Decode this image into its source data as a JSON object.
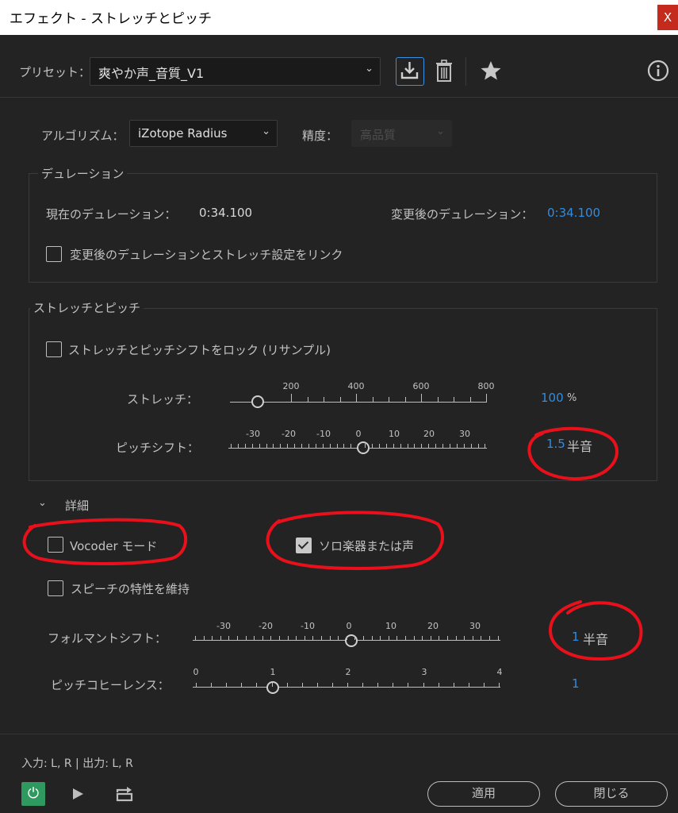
{
  "window": {
    "title": "エフェクト - ストレッチとピッチ",
    "close_glyph": "X"
  },
  "preset": {
    "label": "プリセット：",
    "value": "爽やか声_音質_V1"
  },
  "algorithm": {
    "label": "アルゴリズム：",
    "value": "iZotope Radius",
    "precision_label": "精度：",
    "precision_value": "高品質"
  },
  "duration": {
    "group_label": "デュレーション",
    "current_label": "現在のデュレーション：",
    "current_value": "0:34.100",
    "new_label": "変更後のデュレーション：",
    "new_value": "0:34.100",
    "link_label": "変更後のデュレーションとストレッチ設定をリンク",
    "link_checked": false
  },
  "stretch_pitch": {
    "group_label": "ストレッチとピッチ",
    "lock_label": "ストレッチとピッチシフトをロック (リサンプル)",
    "lock_checked": false,
    "stretch": {
      "label": "ストレッチ：",
      "ticks": [
        "200",
        "400",
        "600",
        "800"
      ],
      "value": "100",
      "unit": "%"
    },
    "pitch": {
      "label": "ピッチシフト：",
      "ticks": [
        "-30",
        "-20",
        "-10",
        "0",
        "10",
        "20",
        "30"
      ],
      "value": "1.5",
      "unit": "半音"
    }
  },
  "details": {
    "label": "詳細",
    "vocoder_label": "Vocoder モード",
    "vocoder_checked": false,
    "solo_label": "ソロ楽器または声",
    "solo_checked": true,
    "speech_label": "スピーチの特性を維持",
    "speech_checked": false,
    "formant": {
      "label": "フォルマントシフト：",
      "ticks": [
        "-30",
        "-20",
        "-10",
        "0",
        "10",
        "20",
        "30"
      ],
      "value": "1",
      "unit": "半音"
    },
    "coherence": {
      "label": "ピッチコヒーレンス：",
      "ticks": [
        "0",
        "1",
        "2",
        "3",
        "4"
      ],
      "value": "1"
    }
  },
  "footer": {
    "io_text": "入力: L, R | 出力: L, R",
    "apply_label": "適用",
    "close_label": "閉じる"
  },
  "colors": {
    "accent_blue": "#2f8de4",
    "power_green": "#2e9a5f",
    "annotation_red": "#e8111b"
  },
  "icons": [
    "save-icon",
    "trash-icon",
    "star-icon",
    "info-icon",
    "chevron-down-icon",
    "power-icon",
    "play-icon",
    "loop-icon"
  ]
}
